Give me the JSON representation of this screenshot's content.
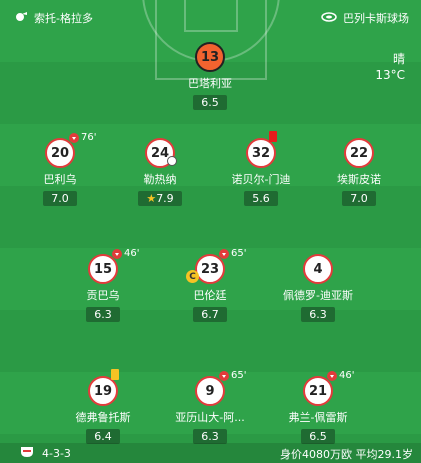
{
  "header": {
    "home_team": "索托-格拉多",
    "venue": "巴列卡斯球场"
  },
  "weather": {
    "condition": "晴",
    "temperature": "13°C"
  },
  "players": [
    {
      "number": "13",
      "name": "巴塔利亚",
      "rating": "6.5",
      "role": "goalkeeper"
    },
    {
      "number": "20",
      "name": "巴利乌",
      "rating": "7.0",
      "sub_time": "76'"
    },
    {
      "number": "24",
      "name": "勒热纳",
      "rating": "7.9",
      "motm": true,
      "goal": true
    },
    {
      "number": "32",
      "name": "诺贝尔-门迪",
      "rating": "5.6",
      "card": "red"
    },
    {
      "number": "22",
      "name": "埃斯皮诺",
      "rating": "7.0"
    },
    {
      "number": "15",
      "name": "贡巴乌",
      "rating": "6.3",
      "sub_time": "46'"
    },
    {
      "number": "23",
      "name": "巴伦廷",
      "rating": "6.7",
      "sub_time": "65'",
      "captain": true
    },
    {
      "number": "4",
      "name": "佩德罗-迪亚斯",
      "rating": "6.3"
    },
    {
      "number": "19",
      "name": "德弗鲁托斯",
      "rating": "6.4",
      "card": "yellow"
    },
    {
      "number": "9",
      "name": "亚历山大-阿...",
      "rating": "6.3",
      "sub_time": "65'"
    },
    {
      "number": "21",
      "name": "弗兰-佩雷斯",
      "rating": "6.5",
      "sub_time": "46'"
    }
  ],
  "footer": {
    "formation": "4-3-3",
    "team_stats": "身价4080万欧 平均29.1岁"
  },
  "colors": {
    "pitch_green": "#2fa34a",
    "rating_bg": "#1f6b32",
    "home_red": "#e23b3b",
    "goalkeeper_orange": "#f2632f",
    "yellow_card": "#f6c324"
  },
  "labels": {
    "captain": "C"
  }
}
